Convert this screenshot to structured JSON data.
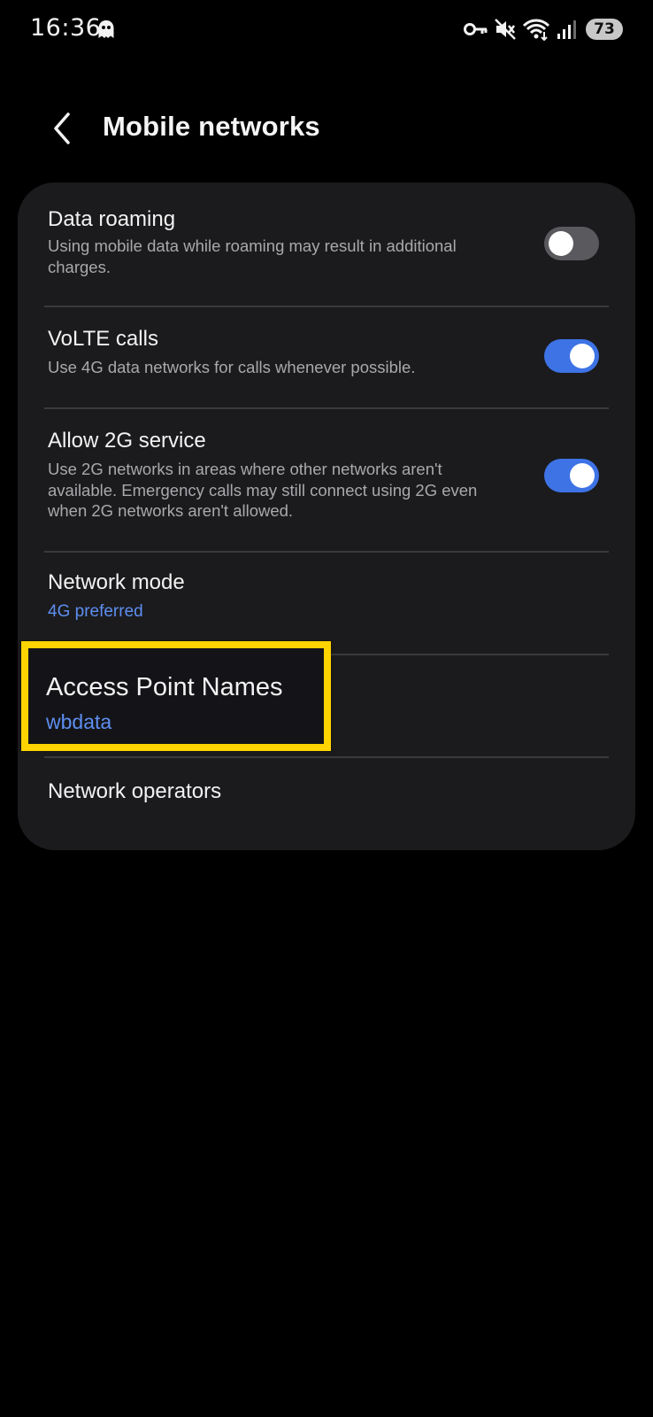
{
  "status_bar": {
    "time": "16:36",
    "battery": "73",
    "icons": [
      "ghost-icon",
      "vpn-key-icon",
      "mute-icon",
      "wifi-icon",
      "signal-icon",
      "battery-icon"
    ]
  },
  "header": {
    "title": "Mobile networks",
    "back_icon": "chevron-left-icon"
  },
  "settings": {
    "data_roaming": {
      "title": "Data roaming",
      "desc": "Using mobile data while roaming may result in additional charges.",
      "enabled": false
    },
    "volte_calls": {
      "title": "VoLTE calls",
      "desc": "Use 4G data networks for calls whenever possible.",
      "enabled": true
    },
    "allow_2g": {
      "title": "Allow 2G service",
      "desc": "Use 2G networks in areas where other networks aren't available. Emergency calls may still connect using 2G even when 2G networks aren't allowed.",
      "enabled": true
    },
    "network_mode": {
      "title": "Network mode",
      "value": "4G preferred"
    },
    "access_point_names": {
      "title": "Access Point Names",
      "value": "wbdata"
    },
    "network_operators": {
      "title": "Network operators"
    }
  },
  "colors": {
    "background": "#000000",
    "card": "#1b1b1d",
    "accent": "#3e73e6",
    "link": "#5e8ef0",
    "highlight_border": "#ffd400"
  }
}
